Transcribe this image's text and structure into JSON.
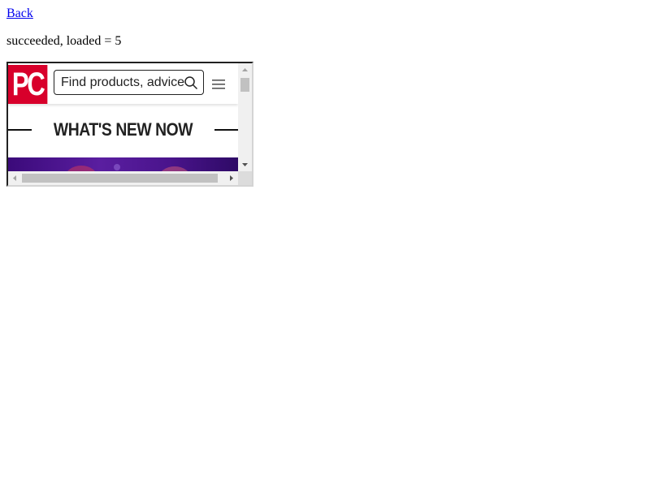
{
  "page": {
    "back_link": "Back",
    "status": "succeeded, loaded = 5"
  },
  "embedded_site": {
    "logo_text": "PC",
    "brand_color": "#d8002b",
    "search": {
      "placeholder": "Find products, advice",
      "icon": "search-icon"
    },
    "menu_icon": "hamburger-menu-icon",
    "section_heading": "WHAT'S NEW NOW",
    "hero_colors": [
      "#3b0a7a",
      "#5a1ea0",
      "#4a148c"
    ]
  },
  "scrollbars": {
    "vertical_position": 0,
    "horizontal_position": 0
  }
}
